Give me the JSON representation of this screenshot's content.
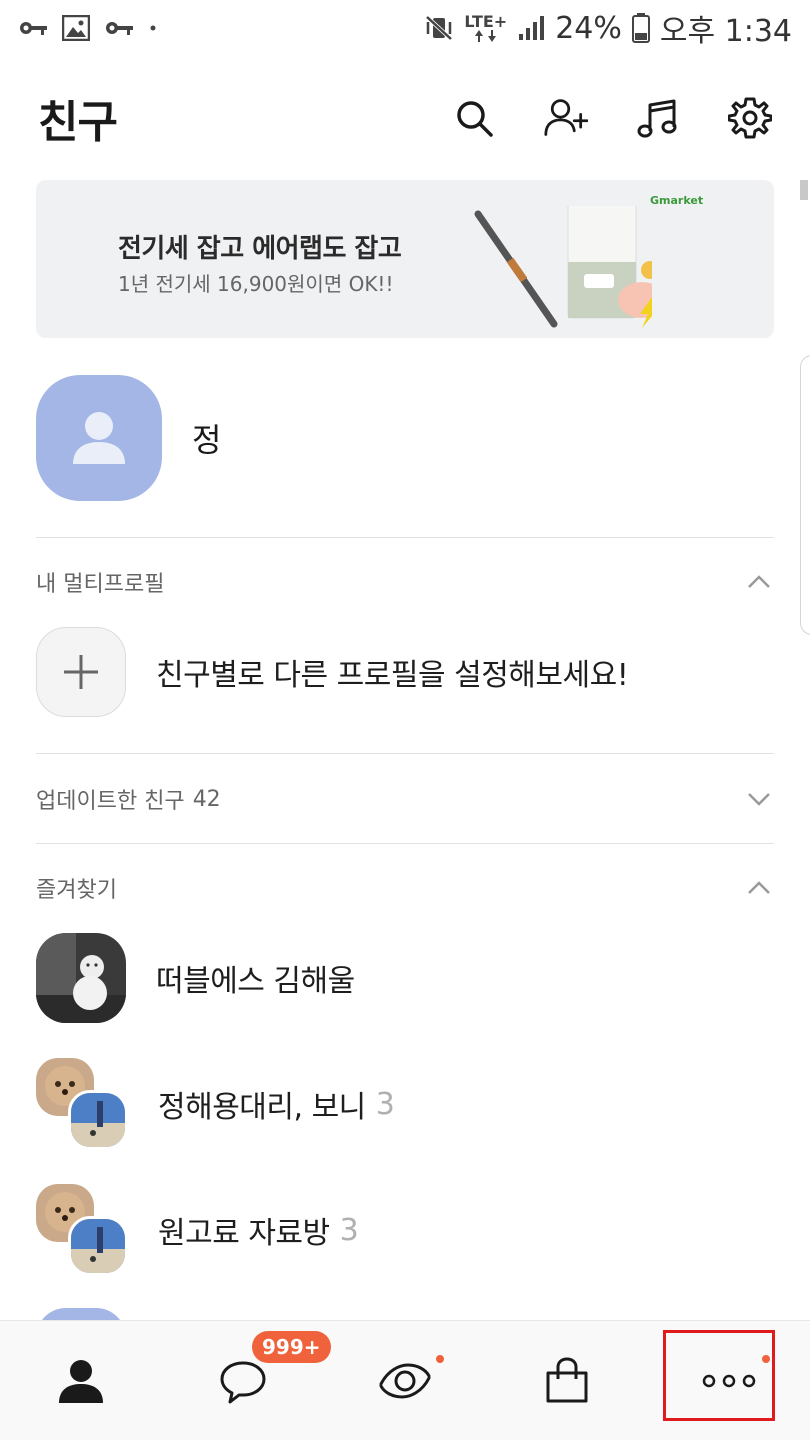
{
  "status_bar": {
    "icons_left": [
      "key-icon",
      "image-icon",
      "key-icon",
      "dot-icon"
    ],
    "icons_right": [
      "mute-vibrate-icon",
      "lte-signal-icon",
      "signal-bars-icon"
    ],
    "network": "LTE+",
    "battery": "24%",
    "time": "오후 1:34"
  },
  "header": {
    "title": "친구",
    "actions": [
      "search-icon",
      "add-friend-icon",
      "music-icon",
      "settings-icon"
    ]
  },
  "banner": {
    "title": "전기세 잡고 에어랩도 잡고",
    "subtitle": "1년 전기세 16,900원이면 OK!!",
    "brand": "Gmarket"
  },
  "my_profile": {
    "name": "정"
  },
  "multi_profile": {
    "label": "내 멀티프로필",
    "cta": "친구별로 다른 프로필을 설정해보세요!"
  },
  "updated_friends": {
    "label": "업데이트한 친구",
    "count": "42"
  },
  "favorites": {
    "label": "즐겨찾기",
    "items": [
      {
        "name": "떠블에스 김해울",
        "count": ""
      },
      {
        "name": "정해용대리, 보니",
        "count": "3"
      },
      {
        "name": "원고료 자료방",
        "count": "3"
      }
    ]
  },
  "bottom_nav": {
    "items": [
      "friends-icon",
      "chats-icon",
      "view-icon",
      "shopping-icon",
      "more-icon"
    ],
    "chat_badge": "999+"
  },
  "colors": {
    "accent": "#f0623b",
    "avatar": "#a4b6e6",
    "highlight": "#e01b1b"
  }
}
